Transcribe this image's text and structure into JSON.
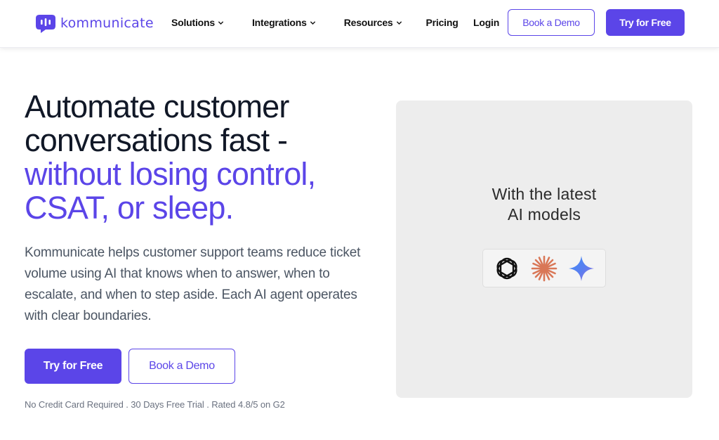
{
  "brand": {
    "name": "kommunicate",
    "color": "#5b45e8",
    "logo_icon": "chat-bubble-logo-icon"
  },
  "nav": {
    "items": [
      {
        "label": "Solutions",
        "has_dropdown": true
      },
      {
        "label": "Integrations",
        "has_dropdown": true
      },
      {
        "label": "Resources",
        "has_dropdown": true
      },
      {
        "label": "Pricing",
        "has_dropdown": false
      }
    ],
    "login_label": "Login",
    "book_demo_label": "Book a Demo",
    "try_free_label": "Try for Free"
  },
  "hero": {
    "title_line1": "Automate customer",
    "title_line2": "conversations fast -",
    "title_line3": "without losing control,",
    "title_line4": "CSAT, or sleep.",
    "description": "Kommunicate helps customer support teams reduce ticket volume using AI that knows when to answer, when to escalate, and when to step aside. Each AI agent operates with clear boundaries.",
    "primary_cta": "Try for Free",
    "secondary_cta": "Book a Demo",
    "fineprint": "No Credit Card Required . 30 Days Free Trial . Rated 4.8/5 on G2"
  },
  "panel": {
    "heading_line1": "With the latest",
    "heading_line2": "AI models",
    "models": [
      {
        "icon": "openai-icon",
        "color": "#111111"
      },
      {
        "icon": "claude-icon",
        "color": "#d97757"
      },
      {
        "icon": "gemini-icon",
        "color": "#4f7ef0"
      }
    ]
  },
  "colors": {
    "accent": "#5b45e8",
    "text_dark": "#111827",
    "text_muted": "#4b5563",
    "panel_bg": "#ededed"
  }
}
